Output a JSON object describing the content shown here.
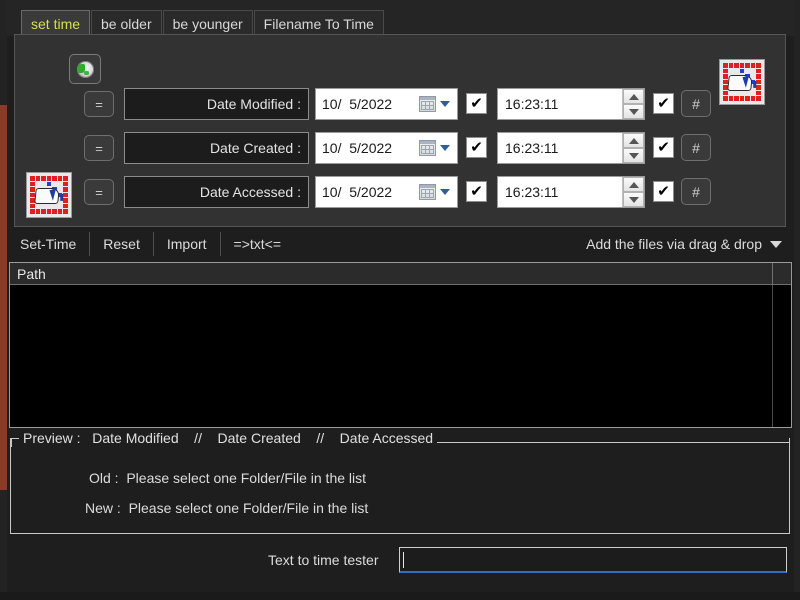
{
  "window": {
    "accent_red": "#8c3a28",
    "active_tab_text_color": "#d7e04f",
    "focus_underline_color": "#2f6fbd"
  },
  "tabs": [
    {
      "label": "set time",
      "active": true
    },
    {
      "label": "be older",
      "active": false
    },
    {
      "label": "be younger",
      "active": false
    },
    {
      "label": "Filename To Time",
      "active": false
    }
  ],
  "panel": {
    "globe_button": {
      "icon": "globe-icon"
    },
    "drag_drop_icon_top": {
      "icon": "drag-drop-icon"
    },
    "drag_drop_icon_left": {
      "icon": "drag-drop-icon"
    },
    "rows": [
      {
        "equals_label": "=",
        "field_label": "Date Modified :",
        "date_value": "10/  5/2022",
        "date_checkbox_checked": true,
        "date_checkbox_mark": "✔",
        "time_value": "16:23:11",
        "time_checkbox_checked": true,
        "time_checkbox_mark": "✔",
        "hash_label": "#"
      },
      {
        "equals_label": "=",
        "field_label": "Date Created :",
        "date_value": "10/  5/2022",
        "date_checkbox_checked": true,
        "date_checkbox_mark": "✔",
        "time_value": "16:23:11",
        "time_checkbox_checked": true,
        "time_checkbox_mark": "✔",
        "hash_label": "#"
      },
      {
        "equals_label": "=",
        "field_label": "Date Accessed :",
        "date_value": "10/  5/2022",
        "date_checkbox_checked": true,
        "date_checkbox_mark": "✔",
        "time_value": "16:23:11",
        "time_checkbox_checked": true,
        "time_checkbox_mark": "✔",
        "hash_label": "#"
      }
    ]
  },
  "toolbar": {
    "set_time_label": "Set-Time",
    "reset_label": "Reset",
    "import_label": "Import",
    "txt_label": "=>txt<=",
    "dropdown_label": "Add the files via drag & drop"
  },
  "listview": {
    "column_header": "Path",
    "rows": []
  },
  "preview": {
    "legend": "Preview :   Date Modified    //    Date Created    //    Date Accessed",
    "old_line": "Old :  Please select one Folder/File in the list",
    "new_line": "New :  Please select one Folder/File in the list"
  },
  "tester": {
    "label": "Text to time tester",
    "value": "",
    "placeholder": ""
  }
}
